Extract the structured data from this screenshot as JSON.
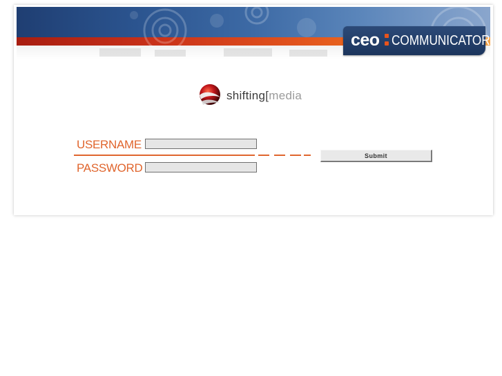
{
  "header": {
    "brand_prefix": "ceo",
    "brand_suffix": "COMMUNICATOR"
  },
  "logo": {
    "name_main": "shifting",
    "name_bracket": "[",
    "name_accent": "media"
  },
  "login": {
    "username_label": "USERNAME",
    "password_label": "PASSWORD",
    "username_value": "",
    "password_value": "",
    "submit_label": "Submit"
  },
  "colors": {
    "accent_orange": "#e0652d",
    "banner_blue": "#1f3e72",
    "banner_red": "#c9321a",
    "field_background": "#e6e6e6"
  }
}
